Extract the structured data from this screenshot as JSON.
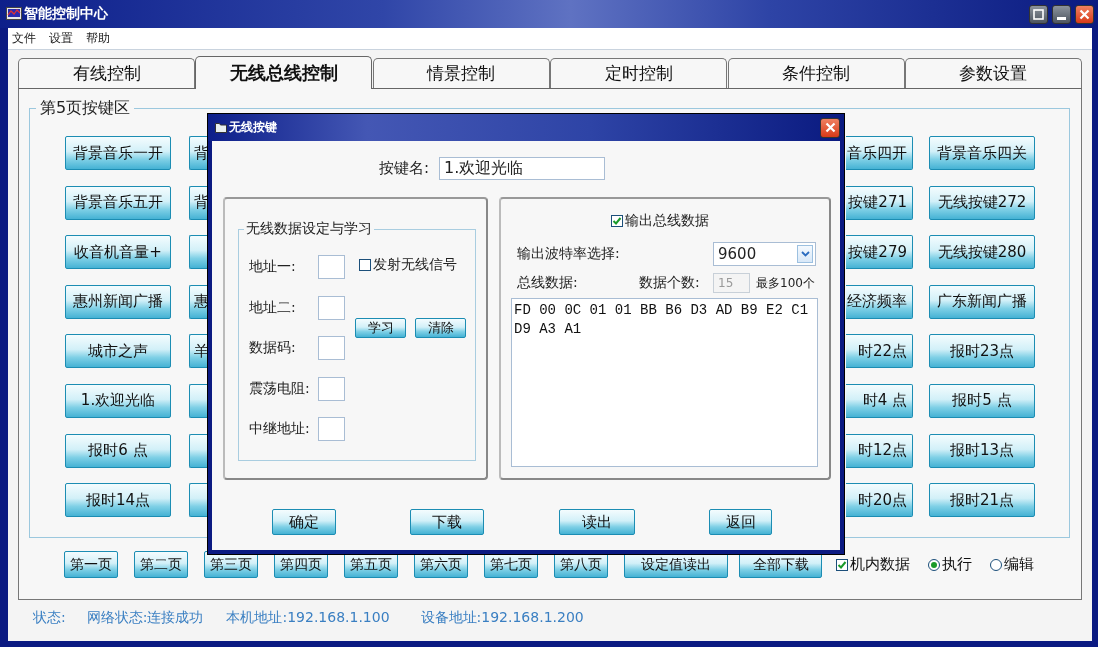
{
  "window": {
    "title": "智能控制中心"
  },
  "menu": [
    "文件",
    "设置",
    "帮助"
  ],
  "tabs": [
    {
      "label": "有线控制",
      "selected": false
    },
    {
      "label": "无线总线控制",
      "selected": true
    },
    {
      "label": "情景控制",
      "selected": false
    },
    {
      "label": "定时控制",
      "selected": false
    },
    {
      "label": "条件控制",
      "selected": false
    },
    {
      "label": "参数设置",
      "selected": false
    }
  ],
  "key_area": {
    "title": "第5页按键区",
    "columns": [
      {
        "kind": "full",
        "keys": [
          "背景音乐一开",
          "背景音乐五开",
          "收音机音量+",
          "惠州新闻广播",
          "城市之声",
          "1.欢迎光临",
          "报时6 点",
          "报时14点"
        ]
      },
      {
        "kind": "clip_right",
        "keys": [
          {
            "kind": "labeled",
            "label": "背"
          },
          {
            "kind": "labeled",
            "label": "背"
          },
          {
            "kind": "blank"
          },
          {
            "kind": "labeled",
            "label": "惠"
          },
          {
            "kind": "labeled",
            "label": "羊"
          },
          {
            "kind": "blank"
          },
          {
            "kind": "blank"
          },
          {
            "kind": "blank"
          }
        ]
      },
      {
        "kind": "clip_left",
        "keys": [
          "音乐四开",
          "按键271",
          "按键279",
          "经济频率",
          "时22点",
          "时4 点",
          "时12点",
          "时20点"
        ]
      },
      {
        "kind": "full",
        "keys": [
          "背景音乐四关",
          "无线按键272",
          "无线按键280",
          "广东新闻广播",
          "报时23点",
          "报时5 点",
          "报时13点",
          "报时21点"
        ]
      }
    ]
  },
  "page_buttons": [
    "第一页",
    "第二页",
    "第三页",
    "第四页",
    "第五页",
    "第六页",
    "第七页",
    "第八页",
    "设定值读出",
    "全部下载"
  ],
  "options": {
    "builtin_data": {
      "label": "机内数据",
      "checked": true
    },
    "modes": [
      {
        "label": "执行",
        "selected": true
      },
      {
        "label": "编辑",
        "selected": false
      }
    ]
  },
  "status_bar": [
    "状态:",
    "网络状态:连接成功",
    "本机地址:192.168.1.100",
    "设备地址:192.168.1.200"
  ],
  "dialog": {
    "title": "无线按键",
    "key_name": {
      "label": "按键名:",
      "value": "1.欢迎光临"
    },
    "wireless_group": {
      "title": "无线数据设定与学习",
      "fields": [
        "地址一:",
        "地址二:",
        "数据码:",
        "震荡电阻:",
        "中继地址:"
      ],
      "send_signal": {
        "label": "发射无线信号",
        "checked": false
      },
      "learn_button": "学习",
      "clear_button": "清除"
    },
    "bus_group": {
      "output_bus": {
        "label": "输出总线数据",
        "checked": true
      },
      "baud_rate": {
        "label": "输出波特率选择:",
        "value": "9600"
      },
      "bus_data_label": "总线数据:",
      "count": {
        "label": "数据个数:",
        "value": "15",
        "disabled": true
      },
      "count_hint": "最多100个",
      "bus_data": "FD 00 0C 01 01 BB B6 D3 AD B9 E2 C1 D9 A3 A1"
    },
    "buttons": [
      "确定",
      "下载",
      "读出",
      "返回"
    ]
  }
}
